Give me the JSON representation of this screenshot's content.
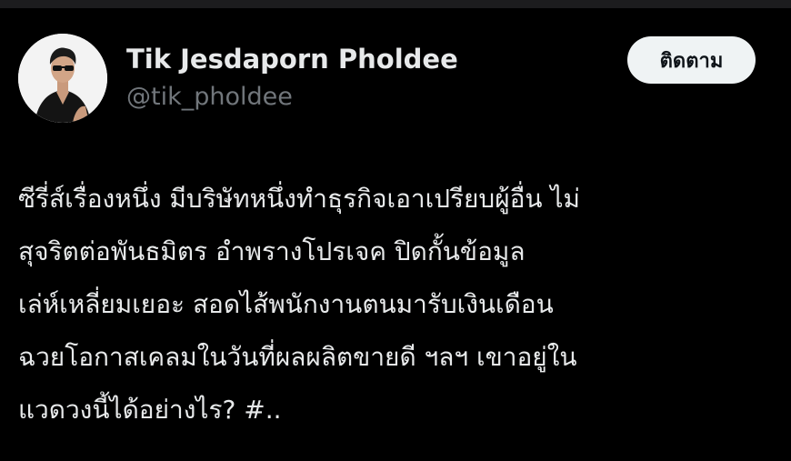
{
  "author": {
    "display_name": "Tik Jesdaporn Pholdee",
    "handle": "@tik_pholdee",
    "avatar_icon": "profile-photo"
  },
  "follow_button": {
    "label": "ติดตาม"
  },
  "tweet": {
    "lines": [
      "ซีรี่ส์เรื่องหนึ่ง มีบริษัทหนึ่งทำธุรกิจเอาเปรียบผู้อื่น ไม่",
      "สุจริตต่อพันธมิตร อำพรางโปรเจค ปิดกั้นข้อมูล",
      "เล่ห์เหลี่ยมเยอะ  สอดไส้พนักงานตนมารับเงินเดือน",
      "ฉวยโอกาสเคลมในวันที่ผลผลิตขายดี ฯลฯ เขาอยู่ใน",
      "แวดวงนี้ได้อย่างไร? #.."
    ]
  },
  "colors": {
    "background": "#000000",
    "text_primary": "#e7e9ea",
    "text_secondary": "#71767b",
    "button_bg": "#eff3f4",
    "button_text": "#0f1419"
  }
}
